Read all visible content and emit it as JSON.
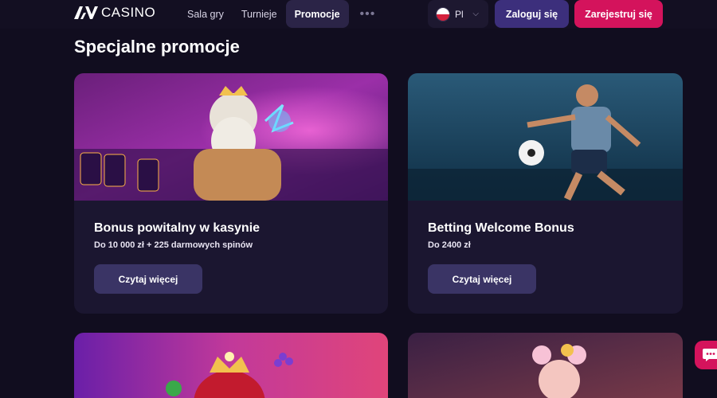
{
  "header": {
    "logo_text": "CASINO",
    "nav": [
      "Sala gry",
      "Turnieje",
      "Promocje"
    ],
    "nav_active": "Promocje",
    "nav_more": "•••",
    "language": "Pl",
    "login_label": "Zaloguj się",
    "register_label": "Zarejestruj się"
  },
  "page_title": "Specjalne promocje",
  "promotions": [
    {
      "title": "Bonus powitalny w kasynie",
      "subtitle": "Do 10 000 zł + 225 darmowych spinów",
      "button": "Czytaj więcej"
    },
    {
      "title": "Betting Welcome Bonus",
      "subtitle": "Do 2400 zł",
      "button": "Czytaj więcej"
    }
  ],
  "colors": {
    "background": "#110d1f",
    "card": "#1b1630",
    "accent_primary": "#3c2f7c",
    "accent_register": "#d4135c",
    "read_more": "#3a3465"
  },
  "icons": [
    "av-logo-icon",
    "flag-pl-icon",
    "chevron-down-icon",
    "more-dots-icon",
    "chat-icon"
  ]
}
